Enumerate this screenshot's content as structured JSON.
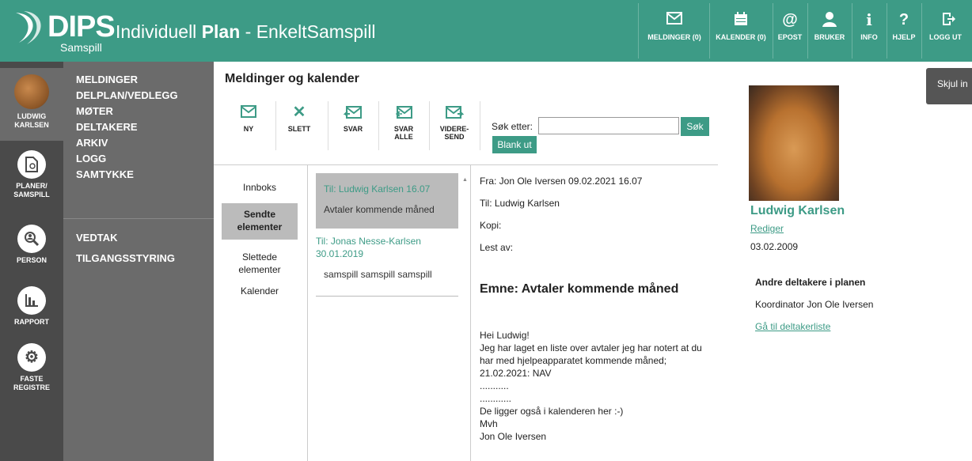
{
  "app": {
    "logo_word": "DIPS",
    "logo_sub": "Samspill",
    "title_prefix": "Individuell ",
    "title_bold": "Plan",
    "title_suffix": " - EnkeltSamspill"
  },
  "topnav": [
    {
      "label": "MELDINGER (0)",
      "icon": "envelope-icon"
    },
    {
      "label": "KALENDER (0)",
      "icon": "calendar-icon"
    },
    {
      "label": "EPOST",
      "icon": "at-icon"
    },
    {
      "label": "BRUKER",
      "icon": "user-icon"
    },
    {
      "label": "INFO",
      "icon": "info-icon"
    },
    {
      "label": "HJELP",
      "icon": "help-icon"
    },
    {
      "label": "LOGG UT",
      "icon": "logout-icon"
    }
  ],
  "leftnav": {
    "user_line1": "LUDWIG",
    "user_line2": "KARLSEN",
    "items": [
      {
        "line1": "PLANER/",
        "line2": "SAMSPILL",
        "icon": "plan-icon"
      },
      {
        "line1": "PERSON",
        "line2": "",
        "icon": "person-search-icon"
      },
      {
        "line1": "RAPPORT",
        "line2": "",
        "icon": "chart-icon"
      },
      {
        "line1": "FASTE",
        "line2": "REGISTRE",
        "icon": "gear-icon"
      }
    ]
  },
  "sidenav": {
    "group1": [
      "MELDINGER",
      "DELPLAN/VEDLEGG",
      "MØTER",
      "DELTAKERE",
      "ARKIV",
      "LOGG",
      "SAMTYKKE"
    ],
    "group2": [
      "VEDTAK",
      "TILGANGSSTYRING"
    ]
  },
  "page": {
    "title": "Meldinger og kalender"
  },
  "toolbar": [
    {
      "label": "NY",
      "label2": "",
      "icon": "envelope-icon"
    },
    {
      "label": "SLETT",
      "label2": "",
      "icon": "delete-icon"
    },
    {
      "label": "SVAR",
      "label2": "",
      "icon": "reply-icon"
    },
    {
      "label": "SVAR",
      "label2": "ALLE",
      "icon": "reply-all-icon"
    },
    {
      "label": "VIDERE-",
      "label2": "SEND",
      "icon": "forward-icon"
    }
  ],
  "search": {
    "label": "Søk etter:",
    "value": "",
    "button": "Søk",
    "clear": "Blank ut"
  },
  "folders": [
    {
      "label": "Innboks",
      "label2": "",
      "selected": false
    },
    {
      "label": "Sendte",
      "label2": "elementer",
      "selected": true
    },
    {
      "label": "Slettede",
      "label2": "elementer",
      "selected": false
    },
    {
      "label": "Kalender",
      "label2": "",
      "selected": false
    }
  ],
  "messages": [
    {
      "to": "Til: Ludwig Karlsen  16.07",
      "subject": "Avtaler kommende måned",
      "selected": true
    },
    {
      "to": "Til: Jonas Nesse-Karlsen  30.01.2019",
      "subject": "samspill samspill samspill",
      "selected": false
    }
  ],
  "reader": {
    "from": "Fra: Jon Ole Iversen 09.02.2021 16.07",
    "to": "Til: Ludwig Karlsen",
    "cc": "Kopi:",
    "read_by": "Lest av:",
    "subject": "Emne: Avtaler kommende måned",
    "body": "Hei Ludwig!\nJeg har laget en liste over avtaler jeg har notert at du har med hjelpeapparatet kommende måned;\n21.02.2021: NAV\n...........\n............\nDe ligger også i kalenderen her :-)\nMvh\nJon Ole Iversen"
  },
  "profile": {
    "name": "Ludwig Karlsen",
    "edit": "Rediger",
    "dob": "03.02.2009",
    "others_title": "Andre deltakere i planen",
    "coordinator": "Koordinator Jon Ole Iversen",
    "participants_link": "Gå til deltakerliste"
  },
  "hide_info": "Skjul in",
  "colors": {
    "accent": "#3d9b86",
    "nav_dark": "#4a4a4a",
    "nav_mid": "#6b6b6b"
  }
}
